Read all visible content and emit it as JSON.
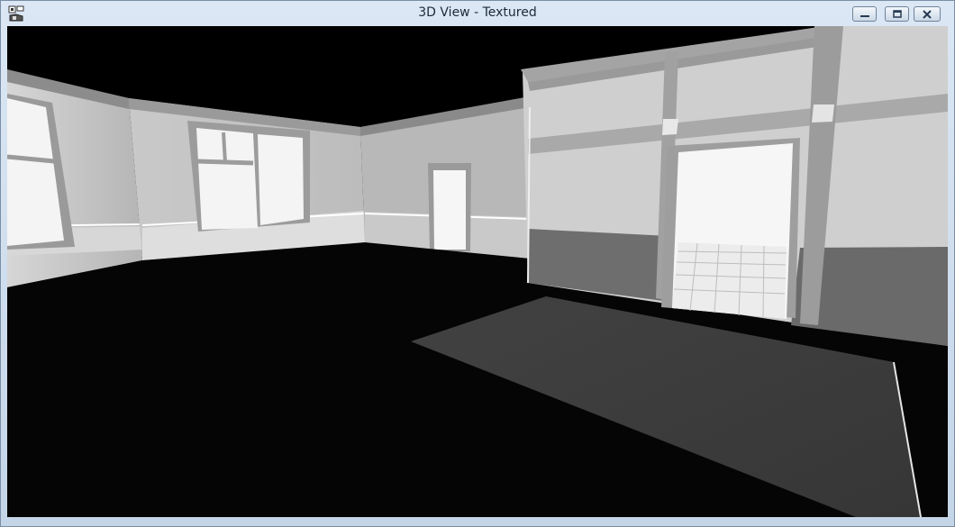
{
  "window": {
    "title": "3D View - Textured",
    "controls": {
      "minimize_icon": "minimize-icon",
      "maximize_icon": "restore-icon",
      "close_icon": "close-icon"
    }
  },
  "viewport": {
    "render_mode": "Textured",
    "colors": {
      "background": "#000000",
      "wall": "#c8c8c8",
      "window_glass": "#f4f4f4",
      "rug": "#3e3e3e"
    }
  }
}
